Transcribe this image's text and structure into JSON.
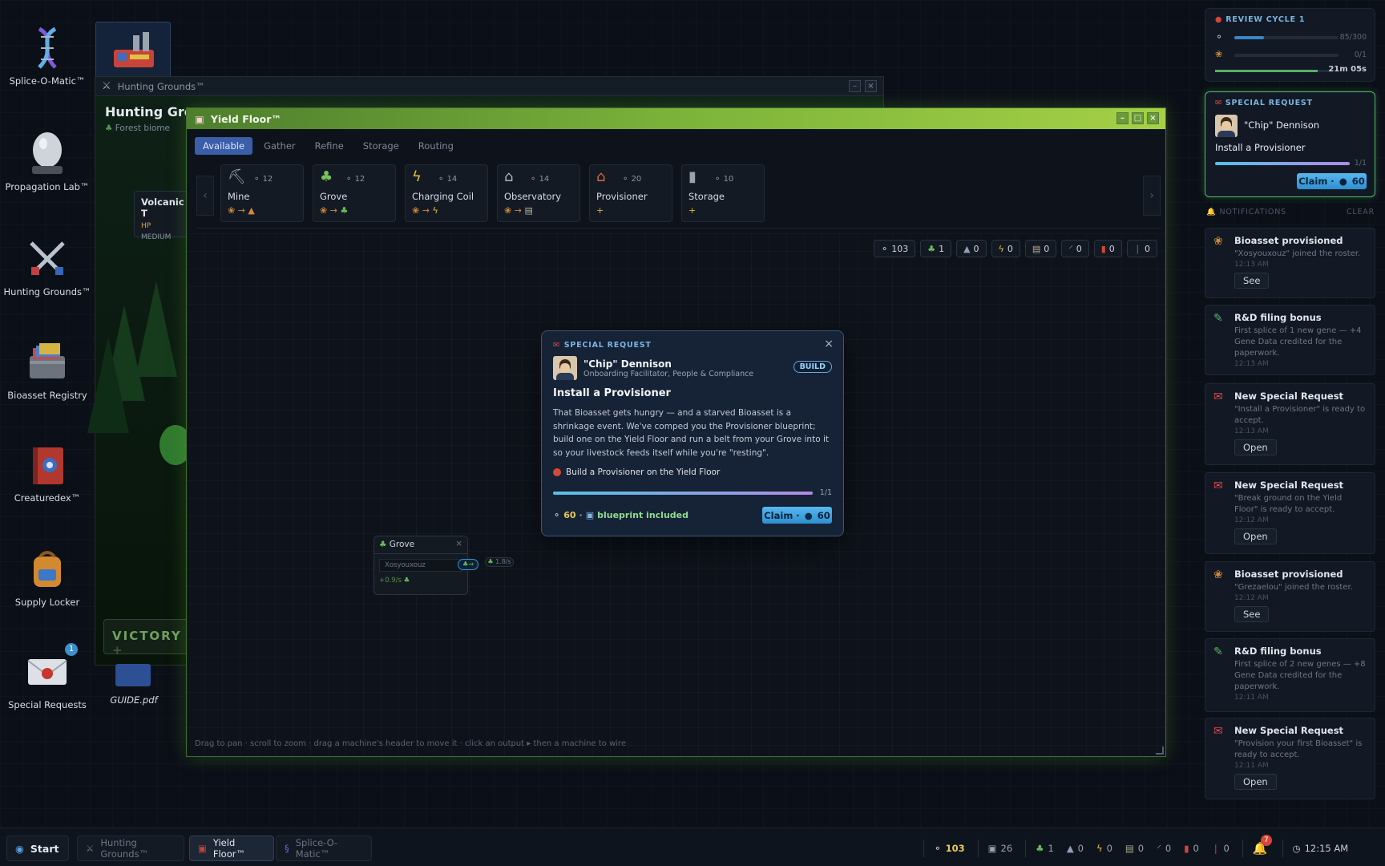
{
  "desktop": {
    "icons": [
      {
        "label": "Splice-O-Matic™",
        "icon": "dna-icon"
      },
      {
        "label": "Propagation Lab™",
        "icon": "egg-icon"
      },
      {
        "label": "Hunting Grounds™",
        "icon": "crossed-swords-icon"
      },
      {
        "label": "Bioasset Registry",
        "icon": "file-box-icon"
      },
      {
        "label": "Creaturedex™",
        "icon": "book-icon"
      },
      {
        "label": "Supply Locker",
        "icon": "backpack-icon"
      },
      {
        "label": "Special Requests",
        "icon": "envelope-icon",
        "badge": "1"
      }
    ],
    "guide_label": "GUIDE.pdf"
  },
  "hunting_window": {
    "title": "Hunting Grounds™",
    "heading": "Hunting Grou",
    "biome": "Forest biome",
    "enemy_name": "Volcanic T",
    "hp_label": "HP",
    "difficulty": "MEDIUM",
    "victory": "VICTORY",
    "victory_plus": "+"
  },
  "yield_window": {
    "title": "Yield Floor™",
    "tabs": [
      "Available",
      "Gather",
      "Refine",
      "Storage",
      "Routing"
    ],
    "machines": [
      {
        "name": "Mine",
        "cost": "12"
      },
      {
        "name": "Grove",
        "cost": "12"
      },
      {
        "name": "Charging Coil",
        "cost": "14"
      },
      {
        "name": "Observatory",
        "cost": "14"
      },
      {
        "name": "Provisioner",
        "cost": "20"
      },
      {
        "name": "Storage",
        "cost": "10"
      }
    ],
    "resource_counts": [
      "103",
      "1",
      "0",
      "0",
      "0",
      "0",
      "0",
      "0"
    ],
    "hint": "Drag to pan · scroll to zoom · drag a machine's header to move it · click an output ▸ then a machine to wire",
    "grove_node": {
      "title": "Grove",
      "slot": "Xosyouxouz",
      "rate_out": "+0.9/s",
      "belt_rate": "1.8/s"
    }
  },
  "modal": {
    "kicker": "SPECIAL REQUEST",
    "person_name": "\"Chip\" Dennison",
    "person_role": "Onboarding Facilitator, People & Compliance",
    "tag": "BUILD",
    "title": "Install a Provisioner",
    "body": "That Bioasset gets hungry — and a starved Bioasset is a shrinkage event. We've comped you the Provisioner blueprint; build one on the Yield Floor and run a belt from your Grove into it so your livestock feeds itself while you're \"resting\".",
    "objective": "Build a Provisioner on the Yield Floor",
    "progress_text": "1/1",
    "progress": 1.0,
    "reward_amount": "60",
    "reward_extra": "blueprint included",
    "claim_label": "Claim ·",
    "claim_amount": "60",
    "close": "×"
  },
  "review_cycle": {
    "title": "REVIEW CYCLE 1",
    "row1_value": "85/300",
    "row1_progress": 0.283,
    "row2_value": "0/1",
    "row2_progress": 0.0,
    "timer": "21m 05s",
    "timer_progress": 0.88
  },
  "special_request_card": {
    "kicker": "SPECIAL REQUEST",
    "name": "\"Chip\" Dennison",
    "task": "Install a Provisioner",
    "progress_text": "1/1",
    "progress": 1.0,
    "claim_label": "Claim ·",
    "claim_amount": "60"
  },
  "notifications": {
    "header": "NOTIFICATIONS",
    "clear": "CLEAR",
    "items": [
      {
        "title": "Bioasset provisioned",
        "desc": "\"Xosyouxouz\" joined the roster.",
        "time": "12:13 AM",
        "action": "See",
        "icon": "paw-icon"
      },
      {
        "title": "R&D filing bonus",
        "desc": "First splice of 1 new gene — +4 Gene Data credited for the paperwork.",
        "time": "12:13 AM",
        "action": "",
        "icon": "pencil-icon"
      },
      {
        "title": "New Special Request",
        "desc": "\"Install a Provisioner\" is ready to accept.",
        "time": "12:13 AM",
        "action": "Open",
        "icon": "envelope-icon"
      },
      {
        "title": "New Special Request",
        "desc": "\"Break ground on the Yield Floor\" is ready to accept.",
        "time": "12:12 AM",
        "action": "Open",
        "icon": "envelope-icon"
      },
      {
        "title": "Bioasset provisioned",
        "desc": "\"Grezaelou\" joined the roster.",
        "time": "12:12 AM",
        "action": "See",
        "icon": "paw-icon"
      },
      {
        "title": "R&D filing bonus",
        "desc": "First splice of 2 new genes — +8 Gene Data credited for the paperwork.",
        "time": "12:11 AM",
        "action": "",
        "icon": "pencil-icon"
      },
      {
        "title": "New Special Request",
        "desc": "\"Provision your first Bioasset\" is ready to accept.",
        "time": "12:11 AM",
        "action": "Open",
        "icon": "envelope-icon"
      }
    ]
  },
  "taskbar": {
    "start": "Start",
    "windows": [
      "Hunting Grounds™",
      "Yield Floor™",
      "Splice-O-Matic™"
    ],
    "tray": [
      "103",
      "26",
      "1",
      "0",
      "0",
      "0",
      "0",
      "0",
      "0"
    ],
    "notif_badge": "7",
    "clock": "12:15 AM"
  },
  "colors": {
    "accent": "#3d9bde",
    "yield_title": "#7bb33a",
    "special": "#57d36a",
    "alert": "#d6453a"
  }
}
